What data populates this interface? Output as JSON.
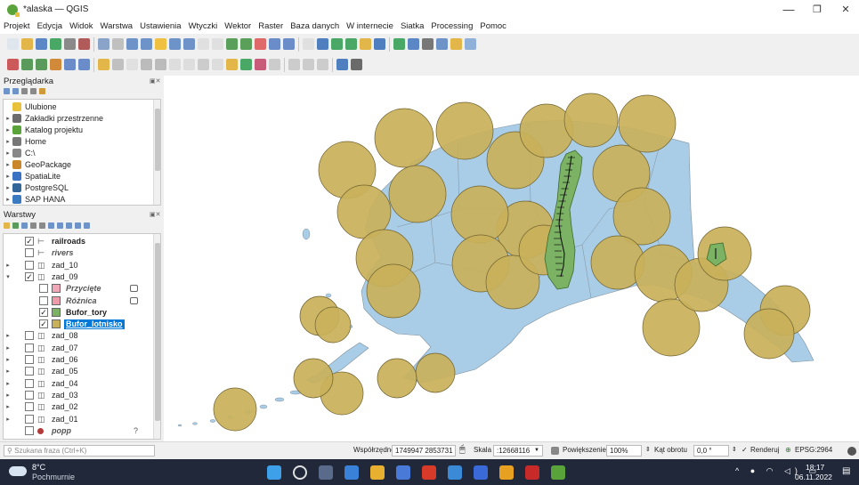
{
  "window": {
    "title": "*alaska — QGIS",
    "minimize": "—",
    "maximize": "❐",
    "close": "✕"
  },
  "menu": [
    "Projekt",
    "Edycja",
    "Widok",
    "Warstwa",
    "Ustawienia",
    "Wtyczki",
    "Wektor",
    "Raster",
    "Baza danych",
    "W internecie",
    "Siatka",
    "Processing",
    "Pomoc"
  ],
  "browser": {
    "title": "Przeglądarka",
    "items": [
      {
        "label": "Ulubione",
        "icon": "star-icon",
        "color": "#e8c23a"
      },
      {
        "label": "Zakładki przestrzenne",
        "icon": "bookmarks-icon",
        "color": "#6d6d6d"
      },
      {
        "label": "Katalog projektu",
        "icon": "project-folder-icon",
        "color": "#5aa33b"
      },
      {
        "label": "Home",
        "icon": "home-icon",
        "color": "#777777"
      },
      {
        "label": "C:\\",
        "icon": "drive-icon",
        "color": "#888888"
      },
      {
        "label": "GeoPackage",
        "icon": "geopackage-icon",
        "color": "#c9862a"
      },
      {
        "label": "SpatiaLite",
        "icon": "spatialite-icon",
        "color": "#3b73c4"
      },
      {
        "label": "PostgreSQL",
        "icon": "postgresql-icon",
        "color": "#33679a"
      },
      {
        "label": "SAP HANA",
        "icon": "saphana-icon",
        "color": "#3a7ac0"
      }
    ]
  },
  "layers": {
    "title": "Warstwy",
    "items": [
      {
        "label": "railroads",
        "checked": true,
        "level": 0,
        "bold": true,
        "italic": false,
        "icon": "line-symbol-icon",
        "expand": ""
      },
      {
        "label": "rivers",
        "checked": false,
        "level": 0,
        "bold": true,
        "italic": true,
        "icon": "line-symbol-icon",
        "expand": ""
      },
      {
        "label": "zad_10",
        "checked": false,
        "level": 0,
        "bold": false,
        "italic": false,
        "icon": "group-icon",
        "expand": "▸"
      },
      {
        "label": "zad_09",
        "checked": true,
        "level": 0,
        "bold": false,
        "italic": false,
        "icon": "group-icon",
        "expand": "▾"
      },
      {
        "label": "Przycięte",
        "checked": false,
        "level": 1,
        "bold": true,
        "italic": true,
        "icon": "polygon-symbol-icon",
        "color": "#f2a7b9",
        "expand": ""
      },
      {
        "label": "Różnica",
        "checked": false,
        "level": 1,
        "bold": true,
        "italic": true,
        "icon": "polygon-symbol-icon",
        "color": "#ef9aab",
        "expand": ""
      },
      {
        "label": "Bufor_tory",
        "checked": true,
        "level": 1,
        "bold": true,
        "italic": false,
        "icon": "polygon-symbol-icon",
        "color": "#7cb263",
        "expand": ""
      },
      {
        "label": "Bufor_lotnisko",
        "checked": true,
        "level": 1,
        "bold": true,
        "italic": false,
        "icon": "polygon-symbol-icon",
        "color": "#c9b15a",
        "expand": "",
        "selected": true
      },
      {
        "label": "zad_08",
        "checked": false,
        "level": 0,
        "bold": false,
        "italic": false,
        "icon": "group-icon",
        "expand": "▸"
      },
      {
        "label": "zad_07",
        "checked": false,
        "level": 0,
        "bold": false,
        "italic": false,
        "icon": "group-icon",
        "expand": "▸"
      },
      {
        "label": "zad_06",
        "checked": false,
        "level": 0,
        "bold": false,
        "italic": false,
        "icon": "group-icon",
        "expand": "▸"
      },
      {
        "label": "zad_05",
        "checked": false,
        "level": 0,
        "bold": false,
        "italic": false,
        "icon": "group-icon",
        "expand": "▸"
      },
      {
        "label": "zad_04",
        "checked": false,
        "level": 0,
        "bold": false,
        "italic": false,
        "icon": "group-icon",
        "expand": "▸"
      },
      {
        "label": "zad_03",
        "checked": false,
        "level": 0,
        "bold": false,
        "italic": false,
        "icon": "group-icon",
        "expand": "▸"
      },
      {
        "label": "zad_02",
        "checked": false,
        "level": 0,
        "bold": false,
        "italic": false,
        "icon": "group-icon",
        "expand": "▸"
      },
      {
        "label": "zad_01",
        "checked": false,
        "level": 0,
        "bold": false,
        "italic": false,
        "icon": "group-icon",
        "expand": "▸"
      },
      {
        "label": "popp",
        "checked": false,
        "level": 0,
        "bold": true,
        "italic": true,
        "icon": "point-symbol-icon",
        "color": "#b33a3a",
        "expand": ""
      }
    ]
  },
  "colors": {
    "ocean": "#ffffff",
    "land": "#a9cde6",
    "buffer_airport": "#c9b15a",
    "buffer_rail": "#7cb263",
    "selection": "#0078d7"
  },
  "status": {
    "search_placeholder": "Szukana fraza (Ctrl+K)",
    "coords_label": "Współrzędne",
    "coords_value": "1749947 2853731",
    "scale_label": "Skala",
    "scale_value": ":12668116",
    "magnifier_label": "Powiększenie",
    "magnifier_value": "100%",
    "rotation_label": "Kąt obrotu",
    "rotation_value": "0,0 °",
    "render_label": "Renderuj",
    "crs": "EPSG:2964"
  },
  "taskbar": {
    "weather_temp": "8°C",
    "weather_text": "Pochmurnie",
    "time": "18:17",
    "date": "06.11.2022"
  }
}
